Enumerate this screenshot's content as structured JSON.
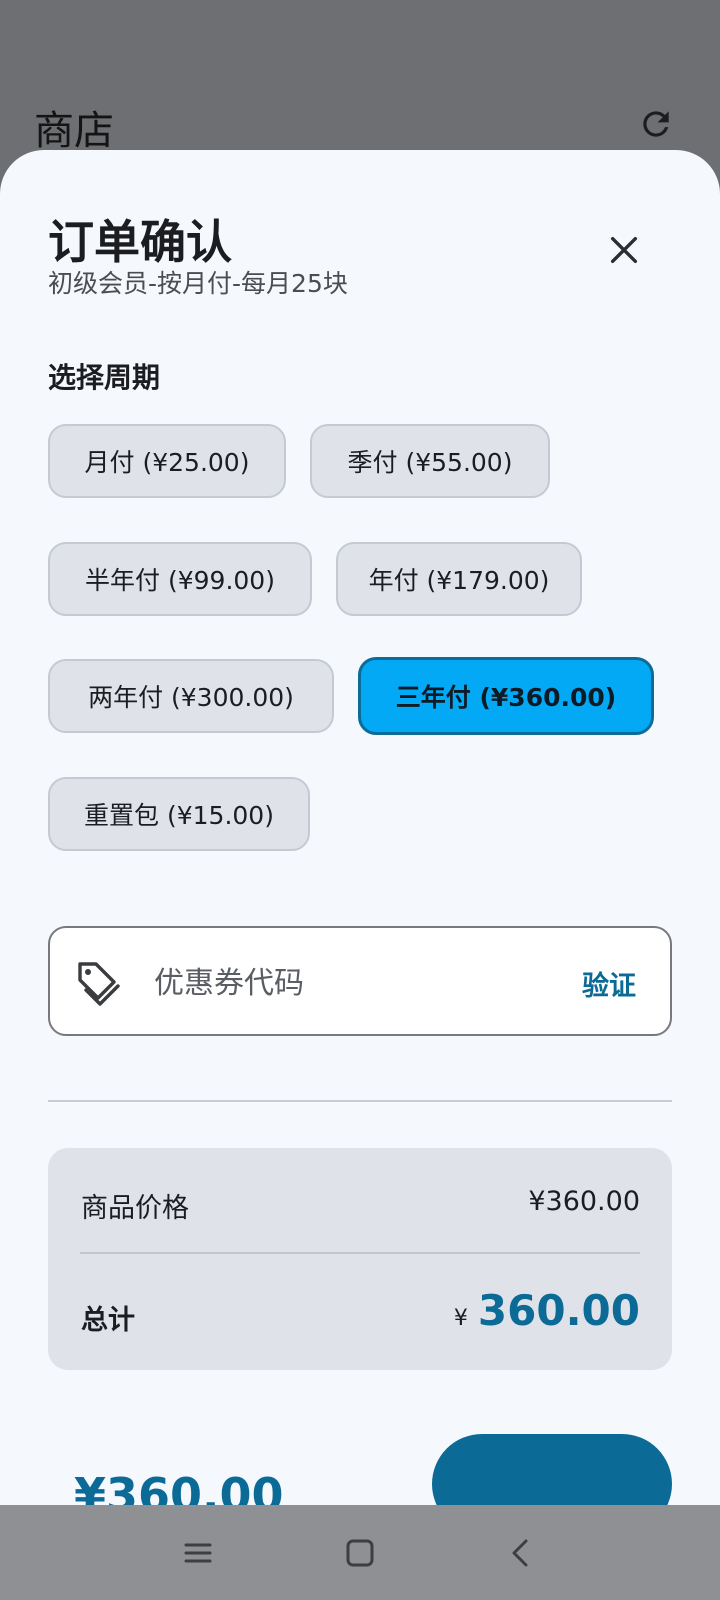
{
  "appbar": {
    "title": "商店",
    "refresh_icon": "refresh-icon"
  },
  "sheet": {
    "title": "订单确认",
    "subtitle": "初级会员-按月付-每月25块",
    "close_icon": "close-icon"
  },
  "period": {
    "label": "选择周期",
    "options": [
      {
        "label": "月付 (¥25.00)",
        "selected": false
      },
      {
        "label": "季付 (¥55.00)",
        "selected": false
      },
      {
        "label": "半年付 (¥99.00)",
        "selected": false
      },
      {
        "label": "年付 (¥179.00)",
        "selected": false
      },
      {
        "label": "两年付 (¥300.00)",
        "selected": false
      },
      {
        "label": "三年付 (¥360.00)",
        "selected": true
      },
      {
        "label": "重置包 (¥15.00)",
        "selected": false
      }
    ]
  },
  "coupon": {
    "placeholder": "优惠券代码",
    "value": "",
    "verify_label": "验证",
    "icon": "tag-icon"
  },
  "summary": {
    "price_label": "商品价格",
    "price_value": "¥360.00",
    "total_label": "总计",
    "total_currency": "¥",
    "total_value": "360.00"
  },
  "footer": {
    "price": "¥360.00"
  },
  "colors": {
    "accent": "#0c6a96",
    "selected_chip": "#03a9f4",
    "sheet_bg": "#f5f8fd",
    "scrim": "#6e6f72"
  },
  "navbar": {
    "icons": [
      "menu-icon",
      "home-icon",
      "back-icon"
    ]
  }
}
